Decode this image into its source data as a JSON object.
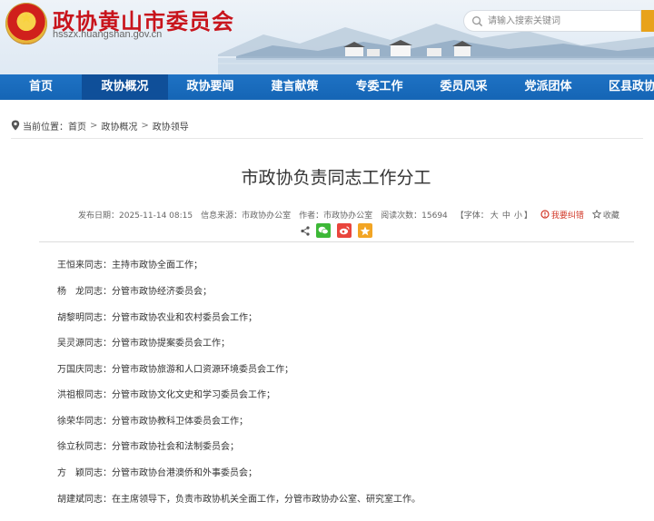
{
  "header": {
    "site_title": "政协黄山市委员会",
    "site_domain": "hsszx.huangshan.gov.cn",
    "search_placeholder": "请输入搜索关键词"
  },
  "nav": {
    "items": [
      {
        "label": "首页"
      },
      {
        "label": "政协概况",
        "active": true
      },
      {
        "label": "政协要闻"
      },
      {
        "label": "建言献策"
      },
      {
        "label": "专委工作"
      },
      {
        "label": "委员风采"
      },
      {
        "label": "党派团体"
      },
      {
        "label": "区县政协"
      }
    ]
  },
  "breadcrumb": {
    "prefix": "当前位置：",
    "items": [
      "首页",
      "政协概况",
      "政协领导"
    ],
    "separator": ">"
  },
  "article": {
    "title": "市政协负责同志工作分工",
    "meta": {
      "publish_date": "发布日期：2025-11-14 08:15",
      "source": "信息来源：市政协办公室",
      "author": "作者：市政协办公室",
      "views": "阅读次数：15694",
      "font_prefix": "【字体：",
      "font_options": [
        "大",
        "中",
        "小"
      ],
      "font_suffix": "】",
      "error_report": "我要纠错",
      "favorite": "收藏"
    },
    "duties": [
      "王恒来同志：主持市政协全面工作；",
      "杨　龙同志：分管市政协经济委员会；",
      "胡黎明同志：分管市政协农业和农村委员会工作；",
      "吴灵源同志：分管市政协提案委员会工作；",
      "万国庆同志：分管市政协旅游和人口资源环境委员会工作；",
      "洪祖根同志：分管市政协文化文史和学习委员会工作；",
      "徐荣华同志：分管市政协教科卫体委员会工作；",
      "徐立秋同志：分管市政协社会和法制委员会；",
      "方　颖同志：分管市政协台港澳侨和外事委员会；",
      "胡建斌同志：在主席领导下，负责市政协机关全面工作，分管市政协办公室、研究室工作。"
    ]
  },
  "colors": {
    "brand_red": "#c8141c",
    "nav_blue": "#1565b5",
    "nav_active": "#0f4f99",
    "accent_orange": "#e8a21b",
    "error_red": "#d23a2a"
  }
}
